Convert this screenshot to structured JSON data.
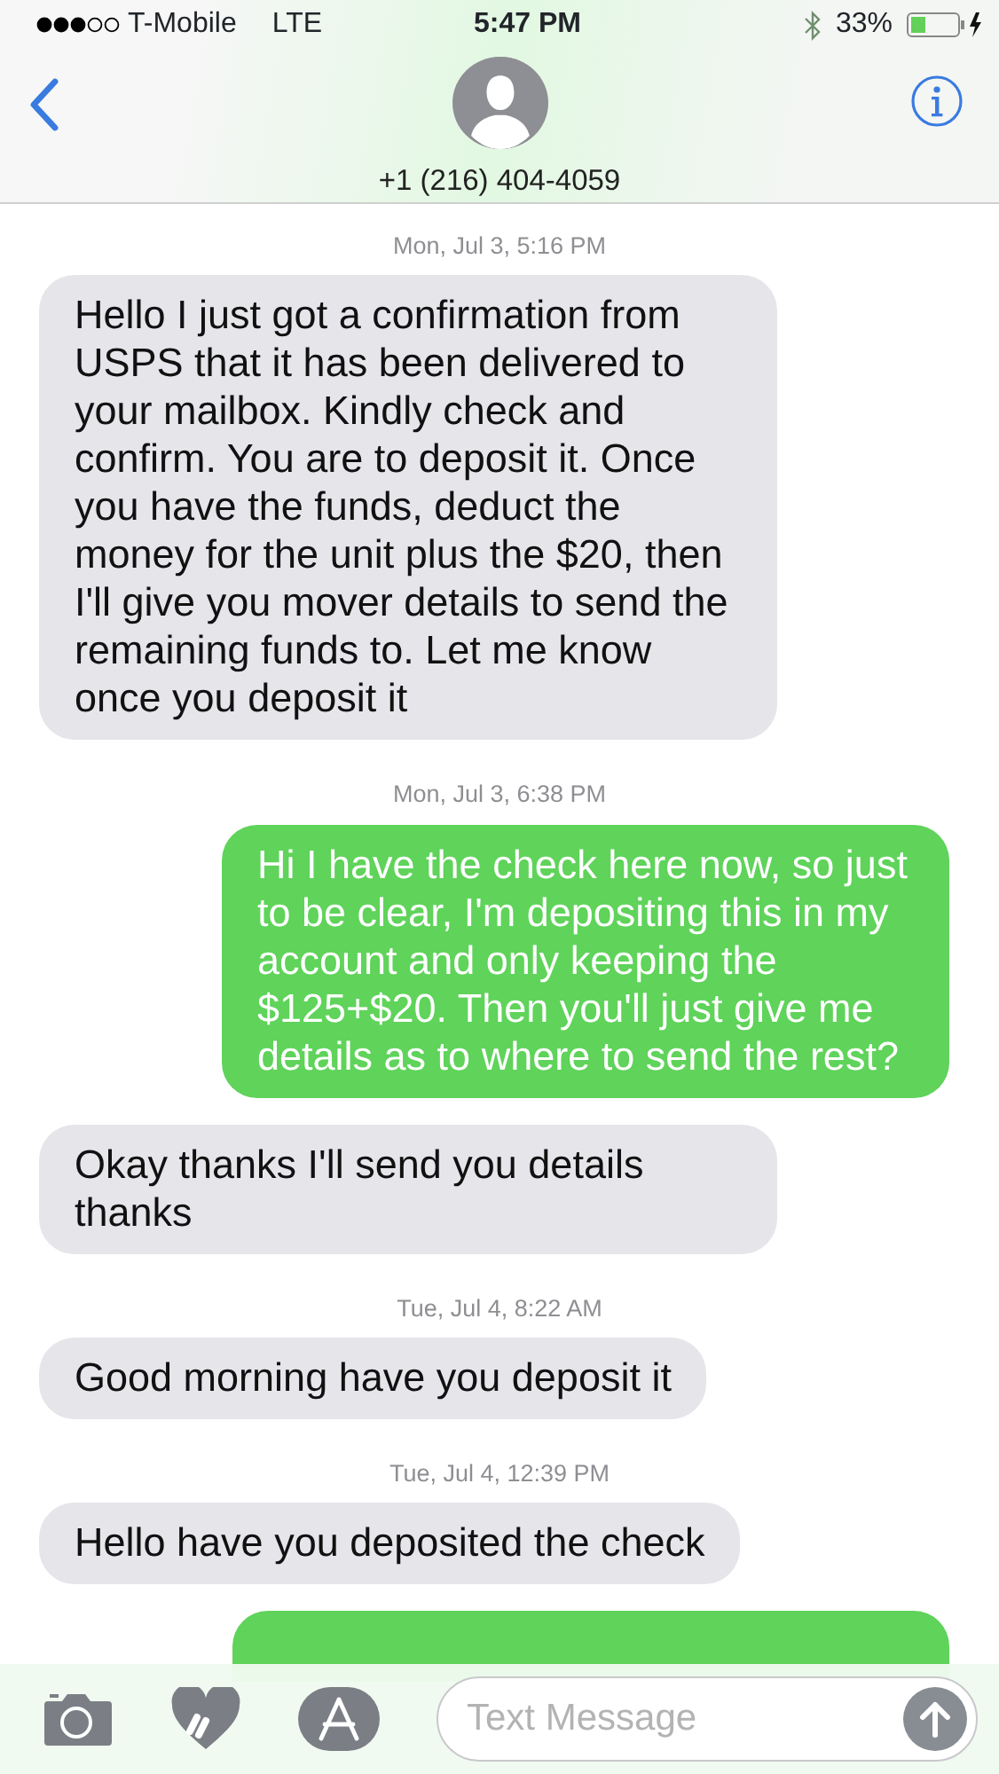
{
  "status_bar": {
    "carrier": "T-Mobile",
    "network": "LTE",
    "time": "5:47 PM",
    "battery": "33%"
  },
  "header": {
    "contact": "+1 (216) 404-4059"
  },
  "messages": [
    {
      "kind": "timestamp",
      "text": "Mon, Jul 3, 5:16 PM"
    },
    {
      "kind": "incoming",
      "text": "Hello I just got a confirmation from USPS that it has been delivered to your mailbox. Kindly check and confirm. You are to deposit it. Once you have the funds, deduct the money for the unit plus the $20, then I'll give you mover details to send the remaining funds to. Let me know once you deposit it"
    },
    {
      "kind": "timestamp",
      "text": "Mon, Jul 3, 6:38 PM"
    },
    {
      "kind": "outgoing",
      "text": "Hi I have the check here now, so just to be clear, I'm depositing this in my account and only keeping the $125+$20. Then you'll just give me details as to where to send the rest?"
    },
    {
      "kind": "incoming",
      "text": "Okay thanks I'll send you details thanks"
    },
    {
      "kind": "timestamp",
      "text": "Tue, Jul 4, 8:22 AM"
    },
    {
      "kind": "incoming",
      "text": "Good morning have you deposit it"
    },
    {
      "kind": "timestamp",
      "text": "Tue, Jul 4, 12:39 PM"
    },
    {
      "kind": "incoming",
      "text": "Hello have you deposited the check"
    },
    {
      "kind": "outgoing-cut"
    }
  ],
  "compose": {
    "placeholder": "Text Message"
  }
}
